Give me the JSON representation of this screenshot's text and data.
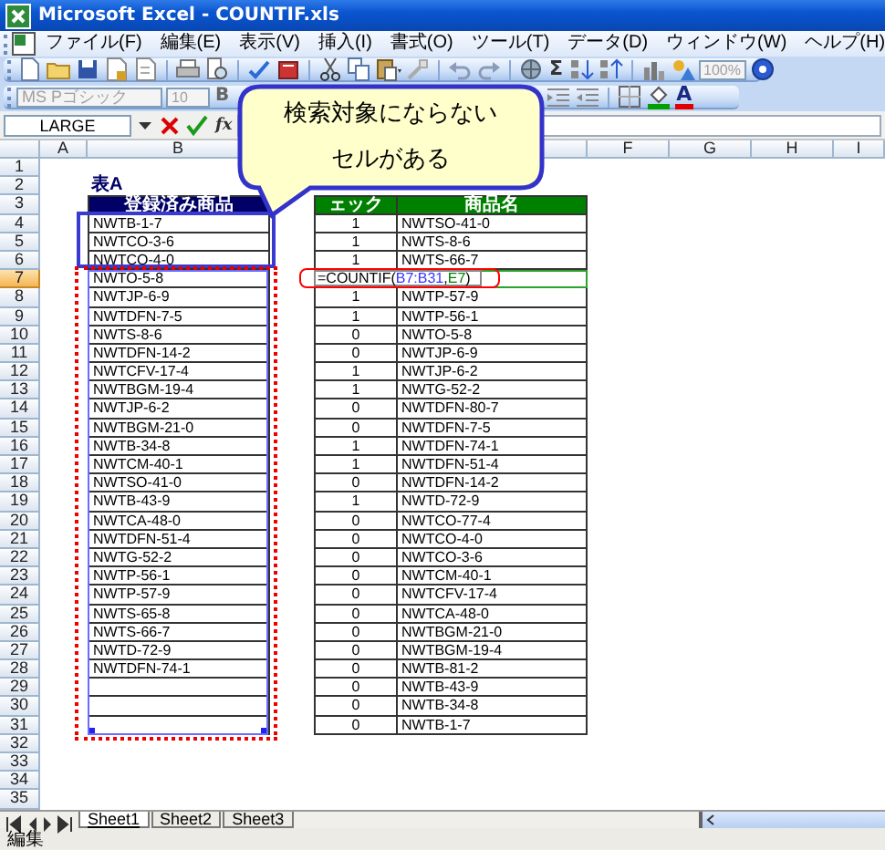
{
  "window": {
    "title": "Microsoft Excel - COUNTIF.xls"
  },
  "menu": [
    {
      "label": "ファイル(F)"
    },
    {
      "label": "編集(E)"
    },
    {
      "label": "表示(V)"
    },
    {
      "label": "挿入(I)"
    },
    {
      "label": "書式(O)"
    },
    {
      "label": "ツール(T)"
    },
    {
      "label": "データ(D)"
    },
    {
      "label": "ウィンドウ(W)"
    },
    {
      "label": "ヘルプ(H)"
    }
  ],
  "toolbar": {
    "sum": "Σ",
    "zoom": {
      "value": "100%",
      "disabled": true
    }
  },
  "format_toolbar": {
    "font": {
      "value": "MS Pゴシック",
      "disabled": true
    },
    "size": {
      "value": "10",
      "disabled": true
    },
    "bold": "B",
    "font_color": "A"
  },
  "formula_bar": {
    "name_box": "LARGE",
    "insert_function": "fx"
  },
  "columns": [
    {
      "label": "A"
    },
    {
      "label": "B"
    },
    {},
    {},
    {},
    {
      "label": "F"
    },
    {
      "label": "G"
    },
    {
      "label": "H"
    },
    {
      "label": "I"
    }
  ],
  "rows": [
    {
      "number": "1",
      "selected": false
    },
    {
      "number": "2",
      "selected": false
    },
    {
      "number": "3",
      "selected": false
    },
    {
      "number": "4",
      "selected": false
    },
    {
      "number": "5",
      "selected": false
    },
    {
      "number": "6",
      "selected": false
    },
    {
      "number": "7",
      "selected": true
    },
    {
      "number": "8",
      "selected": false
    },
    {
      "number": "9",
      "selected": false
    },
    {
      "number": "10",
      "selected": false
    },
    {
      "number": "11",
      "selected": false
    },
    {
      "number": "12",
      "selected": false
    },
    {
      "number": "13",
      "selected": false
    },
    {
      "number": "14",
      "selected": false
    },
    {
      "number": "15",
      "selected": false
    },
    {
      "number": "16",
      "selected": false
    },
    {
      "number": "17",
      "selected": false
    },
    {
      "number": "18",
      "selected": false
    },
    {
      "number": "19",
      "selected": false
    },
    {
      "number": "20",
      "selected": false
    },
    {
      "number": "21",
      "selected": false
    },
    {
      "number": "22",
      "selected": false
    },
    {
      "number": "23",
      "selected": false
    },
    {
      "number": "24",
      "selected": false
    },
    {
      "number": "25",
      "selected": false
    },
    {
      "number": "26",
      "selected": false
    },
    {
      "number": "27",
      "selected": false
    },
    {
      "number": "28",
      "selected": false
    },
    {
      "number": "29",
      "selected": false
    },
    {
      "number": "30",
      "selected": false
    },
    {
      "number": "31",
      "selected": false
    },
    {
      "number": "32",
      "selected": false
    },
    {
      "number": "33",
      "selected": false
    },
    {
      "number": "34",
      "selected": false
    },
    {
      "number": "35",
      "selected": false
    }
  ],
  "table_a": {
    "title": "表A",
    "header": "登録済み商品",
    "items": [
      "NWTB-1-7",
      "NWTCO-3-6",
      "NWTCO-4-0",
      "NWTO-5-8",
      "NWTJP-6-9",
      "NWTDFN-7-5",
      "NWTS-8-6",
      "NWTDFN-14-2",
      "NWTCFV-17-4",
      "NWTBGM-19-4",
      "NWTJP-6-2",
      "NWTBGM-21-0",
      "NWTB-34-8",
      "NWTCM-40-1",
      "NWTSO-41-0",
      "NWTB-43-9",
      "NWTCA-48-0",
      "NWTDFN-51-4",
      "NWTG-52-2",
      "NWTP-56-1",
      "NWTP-57-9",
      "NWTS-65-8",
      "NWTS-66-7",
      "NWTD-72-9",
      "NWTDFN-74-1"
    ]
  },
  "table_b": {
    "headers": [
      "ェック",
      "商品名"
    ],
    "rows": [
      {
        "kind": "value",
        "check": "1",
        "name": "NWTSO-41-0"
      },
      {
        "kind": "value",
        "check": "1",
        "name": "NWTS-8-6"
      },
      {
        "kind": "value",
        "check": "1",
        "name": "NWTS-66-7"
      },
      {
        "kind": "formula",
        "formula": [
          {
            "text": "=COUNTIF("
          },
          {
            "text": "B7:B31",
            "color": "#3333ff"
          },
          {
            "text": ","
          },
          {
            "text": "E7",
            "color": "#008000"
          },
          {
            "text": ")"
          }
        ]
      },
      {
        "kind": "value",
        "check": "1",
        "name": "NWTP-57-9"
      },
      {
        "kind": "value",
        "check": "1",
        "name": "NWTP-56-1"
      },
      {
        "kind": "value",
        "check": "0",
        "name": "NWTO-5-8"
      },
      {
        "kind": "value",
        "check": "0",
        "name": "NWTJP-6-9"
      },
      {
        "kind": "value",
        "check": "1",
        "name": "NWTJP-6-2"
      },
      {
        "kind": "value",
        "check": "1",
        "name": "NWTG-52-2"
      },
      {
        "kind": "value",
        "check": "0",
        "name": "NWTDFN-80-7"
      },
      {
        "kind": "value",
        "check": "0",
        "name": "NWTDFN-7-5"
      },
      {
        "kind": "value",
        "check": "1",
        "name": "NWTDFN-74-1"
      },
      {
        "kind": "value",
        "check": "1",
        "name": "NWTDFN-51-4"
      },
      {
        "kind": "value",
        "check": "0",
        "name": "NWTDFN-14-2"
      },
      {
        "kind": "value",
        "check": "1",
        "name": "NWTD-72-9"
      },
      {
        "kind": "value",
        "check": "0",
        "name": "NWTCO-77-4"
      },
      {
        "kind": "value",
        "check": "0",
        "name": "NWTCO-4-0"
      },
      {
        "kind": "value",
        "check": "0",
        "name": "NWTCO-3-6"
      },
      {
        "kind": "value",
        "check": "0",
        "name": "NWTCM-40-1"
      },
      {
        "kind": "value",
        "check": "0",
        "name": "NWTCFV-17-4"
      },
      {
        "kind": "value",
        "check": "0",
        "name": "NWTCA-48-0"
      },
      {
        "kind": "value",
        "check": "0",
        "name": "NWTBGM-21-0"
      },
      {
        "kind": "value",
        "check": "0",
        "name": "NWTBGM-19-4"
      },
      {
        "kind": "value",
        "check": "0",
        "name": "NWTB-81-2"
      },
      {
        "kind": "value",
        "check": "0",
        "name": "NWTB-43-9"
      },
      {
        "kind": "value",
        "check": "0",
        "name": "NWTB-34-8"
      },
      {
        "kind": "value",
        "check": "0",
        "name": "NWTB-1-7"
      }
    ]
  },
  "callout": {
    "lines": [
      "検索対象にならない",
      "セルがある"
    ]
  },
  "sheet_tabs": [
    {
      "label": "Sheet1",
      "selected": true
    },
    {
      "label": "Sheet2",
      "selected": false
    },
    {
      "label": "Sheet3",
      "selected": false
    }
  ],
  "status_bar": {
    "mode": "編集"
  }
}
